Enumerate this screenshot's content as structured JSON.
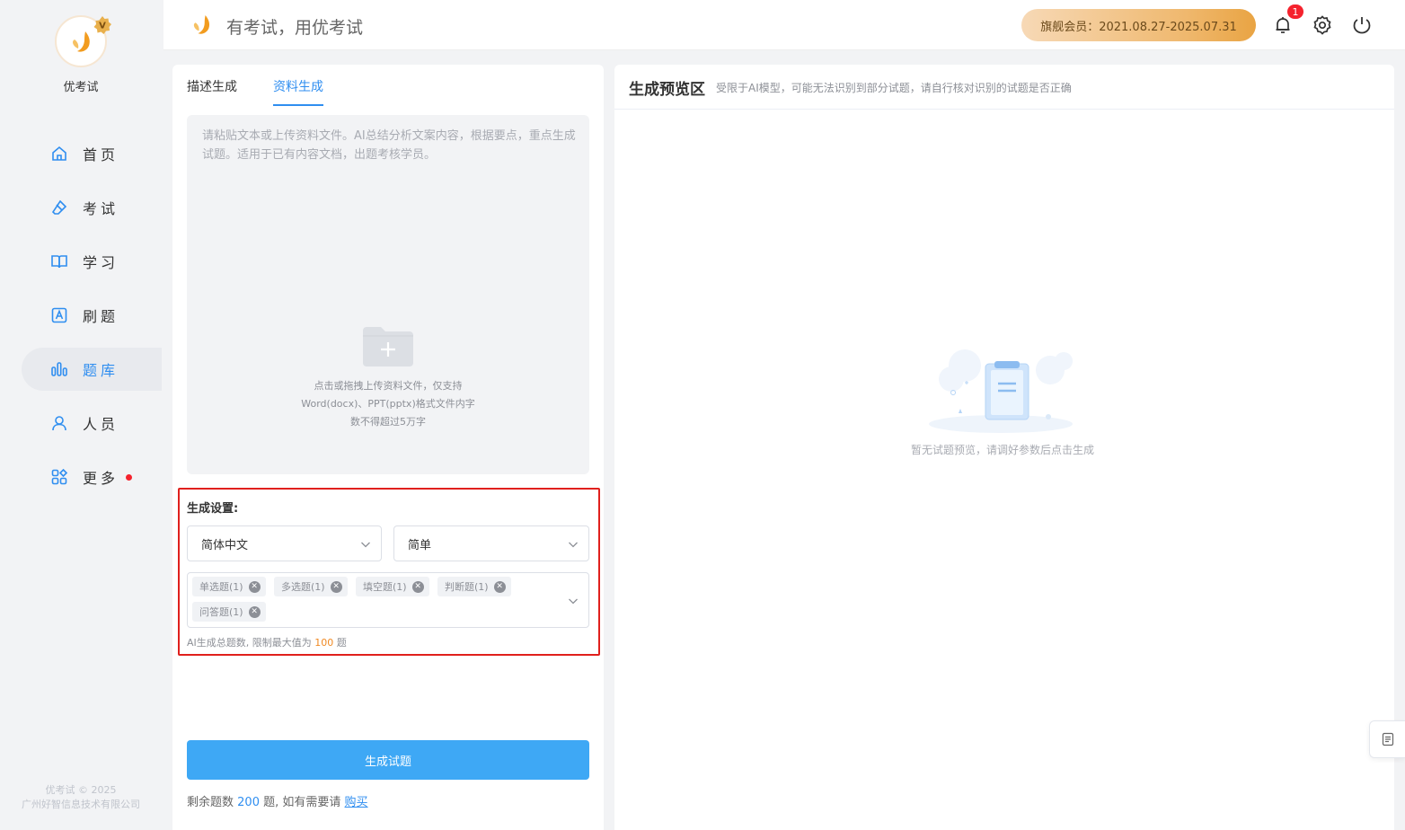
{
  "brand": {
    "name": "优考试",
    "slogan": "有考试，用优考试"
  },
  "sidebar": {
    "items": [
      {
        "label": "首页",
        "icon": "home-icon"
      },
      {
        "label": "考试",
        "icon": "eraser-icon"
      },
      {
        "label": "学习",
        "icon": "book-icon"
      },
      {
        "label": "刷题",
        "icon": "letter-a-icon"
      },
      {
        "label": "题库",
        "icon": "bar-chart-icon",
        "active": true
      },
      {
        "label": "人员",
        "icon": "user-icon"
      },
      {
        "label": "更多",
        "icon": "apps-icon",
        "dot": true
      }
    ],
    "copyright_line1": "优考试 © 2025",
    "copyright_line2": "广州好智信息技术有限公司"
  },
  "header": {
    "membership": "旗舰会员：2021.08.27-2025.07.31",
    "notification_count": "1",
    "icons": [
      "bell-icon",
      "gear-icon",
      "power-icon"
    ]
  },
  "left": {
    "tabs": [
      "描述生成",
      "资料生成"
    ],
    "active_tab": 1,
    "textarea_placeholder": "请粘贴文本或上传资料文件。AI总结分析文案内容，根据要点，重点生成试题。适用于已有内容文档，出题考核学员。",
    "upload_line1": "点击或拖拽上传资料文件，仅支持",
    "upload_line2": "Word(docx)、PPT(pptx)格式文件内字",
    "upload_line3": "数不得超过5万字",
    "settings": {
      "title": "生成设置:",
      "language": "简体中文",
      "difficulty": "简单",
      "tags": [
        "单选题(1)",
        "多选题(1)",
        "填空题(1)",
        "判断题(1)",
        "问答题(1)"
      ],
      "limit_prefix": "AI生成总题数, 限制最大值为",
      "limit_value": "100",
      "limit_suffix": "题"
    },
    "generate_button": "生成试题",
    "remain_prefix": "剩余题数",
    "remain_value": "200",
    "remain_middle": "题, 如有需要请",
    "buy_link": "购买"
  },
  "right": {
    "title": "生成预览区",
    "subtitle": "受限于AI模型，可能无法识别到部分试题，请自行核对识别的试题是否正确",
    "empty_text": "暂无试题预览，请调好参数后点击生成"
  },
  "colors": {
    "accent": "#2f8ef0",
    "button": "#3ea8f5",
    "highlight_border": "#e0201d",
    "orange": "#f08a24"
  }
}
